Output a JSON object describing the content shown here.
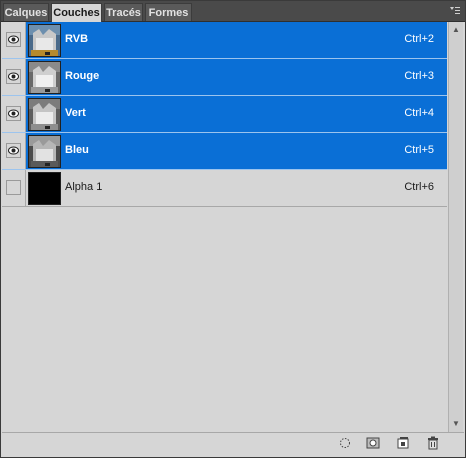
{
  "tabs": [
    {
      "label": "Calques",
      "active": false
    },
    {
      "label": "Couches",
      "active": true
    },
    {
      "label": "Tracés",
      "active": false
    },
    {
      "label": "Formes",
      "active": false
    }
  ],
  "panel_menu_icon": "panel-menu-icon",
  "channels": [
    {
      "name": "RVB",
      "shortcut": "Ctrl+2",
      "visible": true,
      "selected": true,
      "thumbnail": "color"
    },
    {
      "name": "Rouge",
      "shortcut": "Ctrl+3",
      "visible": true,
      "selected": true,
      "thumbnail": "grayscale"
    },
    {
      "name": "Vert",
      "shortcut": "Ctrl+4",
      "visible": true,
      "selected": true,
      "thumbnail": "grayscale"
    },
    {
      "name": "Bleu",
      "shortcut": "Ctrl+5",
      "visible": true,
      "selected": true,
      "thumbnail": "grayscale"
    },
    {
      "name": "Alpha 1",
      "shortcut": "Ctrl+6",
      "visible": false,
      "selected": false,
      "thumbnail": "black"
    }
  ],
  "footer_icons": [
    "load-channel-as-selection-icon",
    "save-selection-as-channel-icon",
    "new-channel-icon",
    "delete-channel-icon"
  ],
  "colors": {
    "selection": "#0a6fd6",
    "panel_bg": "#d6d6d6",
    "tabbar_bg": "#4a4a4a"
  }
}
